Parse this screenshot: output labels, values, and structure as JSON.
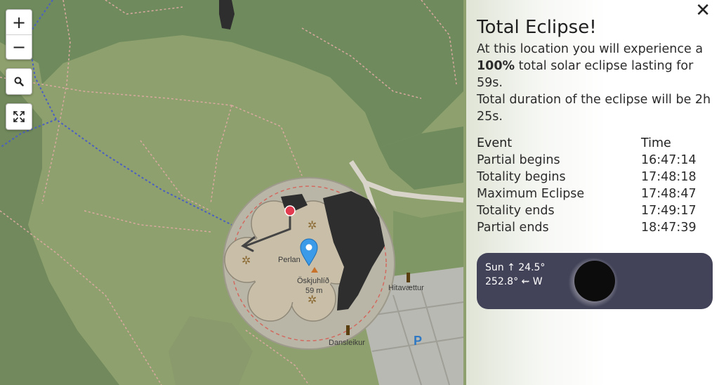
{
  "map": {
    "zoom_in_label": "+",
    "zoom_out_label": "−",
    "search_icon": "search-icon",
    "fullscreen_icon": "fullscreen-icon",
    "labels": {
      "perlan": "Perlan",
      "oskjuhlid": "Öskjuhlíð",
      "elevation": "59 m",
      "hitavaettur": "Hitavættur",
      "dansleikur": "Dansleikur",
      "parking": "P"
    },
    "colors": {
      "forest": "#6f8a5d",
      "meadow": "#8ea06d",
      "building": "#c9bfa9",
      "shadow": "#2e2e2e",
      "pin_blue": "#3c9be8",
      "pin_red": "#e23b4f"
    }
  },
  "panel": {
    "close_label": "✕",
    "title": "Total Eclipse!",
    "description": {
      "line1": "At this location you will experience a",
      "percent": "100%",
      "line2_rest": " total solar eclipse lasting for 59s.",
      "line3": "Total duration of the eclipse will be 2h 25s."
    },
    "table": {
      "headers": {
        "event": "Event",
        "time": "Time"
      },
      "rows": [
        {
          "event": "Partial begins",
          "time": "16:47:14"
        },
        {
          "event": "Totality begins",
          "time": "17:48:18"
        },
        {
          "event": "Maximum Eclipse",
          "time": "17:48:47"
        },
        {
          "event": "Totality ends",
          "time": "17:49:17"
        },
        {
          "event": "Partial ends",
          "time": "18:47:39"
        }
      ]
    },
    "sun_card": {
      "altitude": "Sun ↑ 24.5°",
      "azimuth": "252.8° ⇜ W",
      "background": "#424258"
    }
  }
}
